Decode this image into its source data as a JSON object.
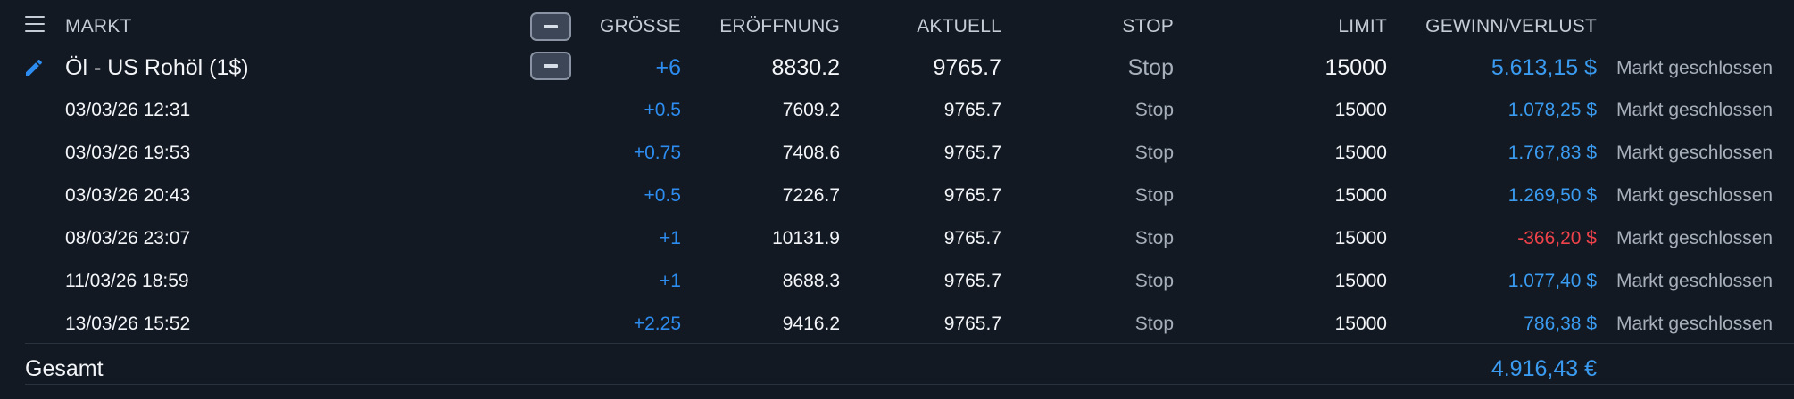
{
  "header": {
    "markt": "MARKT",
    "groesse": "GRÖSSE",
    "eroeffnung": "ERÖFFNUNG",
    "aktuell": "AKTUELL",
    "stop": "STOP",
    "limit": "LIMIT",
    "gewinn_verlust": "GEWINN/VERLUST"
  },
  "position": {
    "market": "Öl - US Rohöl (1$)",
    "size": "+6",
    "open": "8830.2",
    "current": "9765.7",
    "stop": "Stop",
    "limit": "15000",
    "pnl": "5.613,15 $",
    "status": "Markt geschlossen"
  },
  "trades": [
    {
      "date": "03/03/26 12:31",
      "size": "+0.5",
      "open": "7609.2",
      "current": "9765.7",
      "stop": "Stop",
      "limit": "15000",
      "pnl": "1.078,25 $",
      "pnl_sign": "positive",
      "status": "Markt geschlossen"
    },
    {
      "date": "03/03/26 19:53",
      "size": "+0.75",
      "open": "7408.6",
      "current": "9765.7",
      "stop": "Stop",
      "limit": "15000",
      "pnl": "1.767,83 $",
      "pnl_sign": "positive",
      "status": "Markt geschlossen"
    },
    {
      "date": "03/03/26 20:43",
      "size": "+0.5",
      "open": "7226.7",
      "current": "9765.7",
      "stop": "Stop",
      "limit": "15000",
      "pnl": "1.269,50 $",
      "pnl_sign": "positive",
      "status": "Markt geschlossen"
    },
    {
      "date": "08/03/26 23:07",
      "size": "+1",
      "open": "10131.9",
      "current": "9765.7",
      "stop": "Stop",
      "limit": "15000",
      "pnl": "-366,20 $",
      "pnl_sign": "negative",
      "status": "Markt geschlossen"
    },
    {
      "date": "11/03/26 18:59",
      "size": "+1",
      "open": "8688.3",
      "current": "9765.7",
      "stop": "Stop",
      "limit": "15000",
      "pnl": "1.077,40 $",
      "pnl_sign": "positive",
      "status": "Markt geschlossen"
    },
    {
      "date": "13/03/26 15:52",
      "size": "+2.25",
      "open": "9416.2",
      "current": "9765.7",
      "stop": "Stop",
      "limit": "15000",
      "pnl": "786,38 $",
      "pnl_sign": "positive",
      "status": "Markt geschlossen"
    }
  ],
  "total": {
    "label": "Gesamt",
    "value": "4.916,43 €"
  },
  "colors": {
    "background": "#121922",
    "accent_blue": "#2d8cf0",
    "profit": "#3a9bf0",
    "loss": "#f0424a",
    "muted": "#a7afbb"
  },
  "icons": {
    "menu": "hamburger-icon",
    "edit": "pencil-icon",
    "collapse": "minus-icon"
  }
}
